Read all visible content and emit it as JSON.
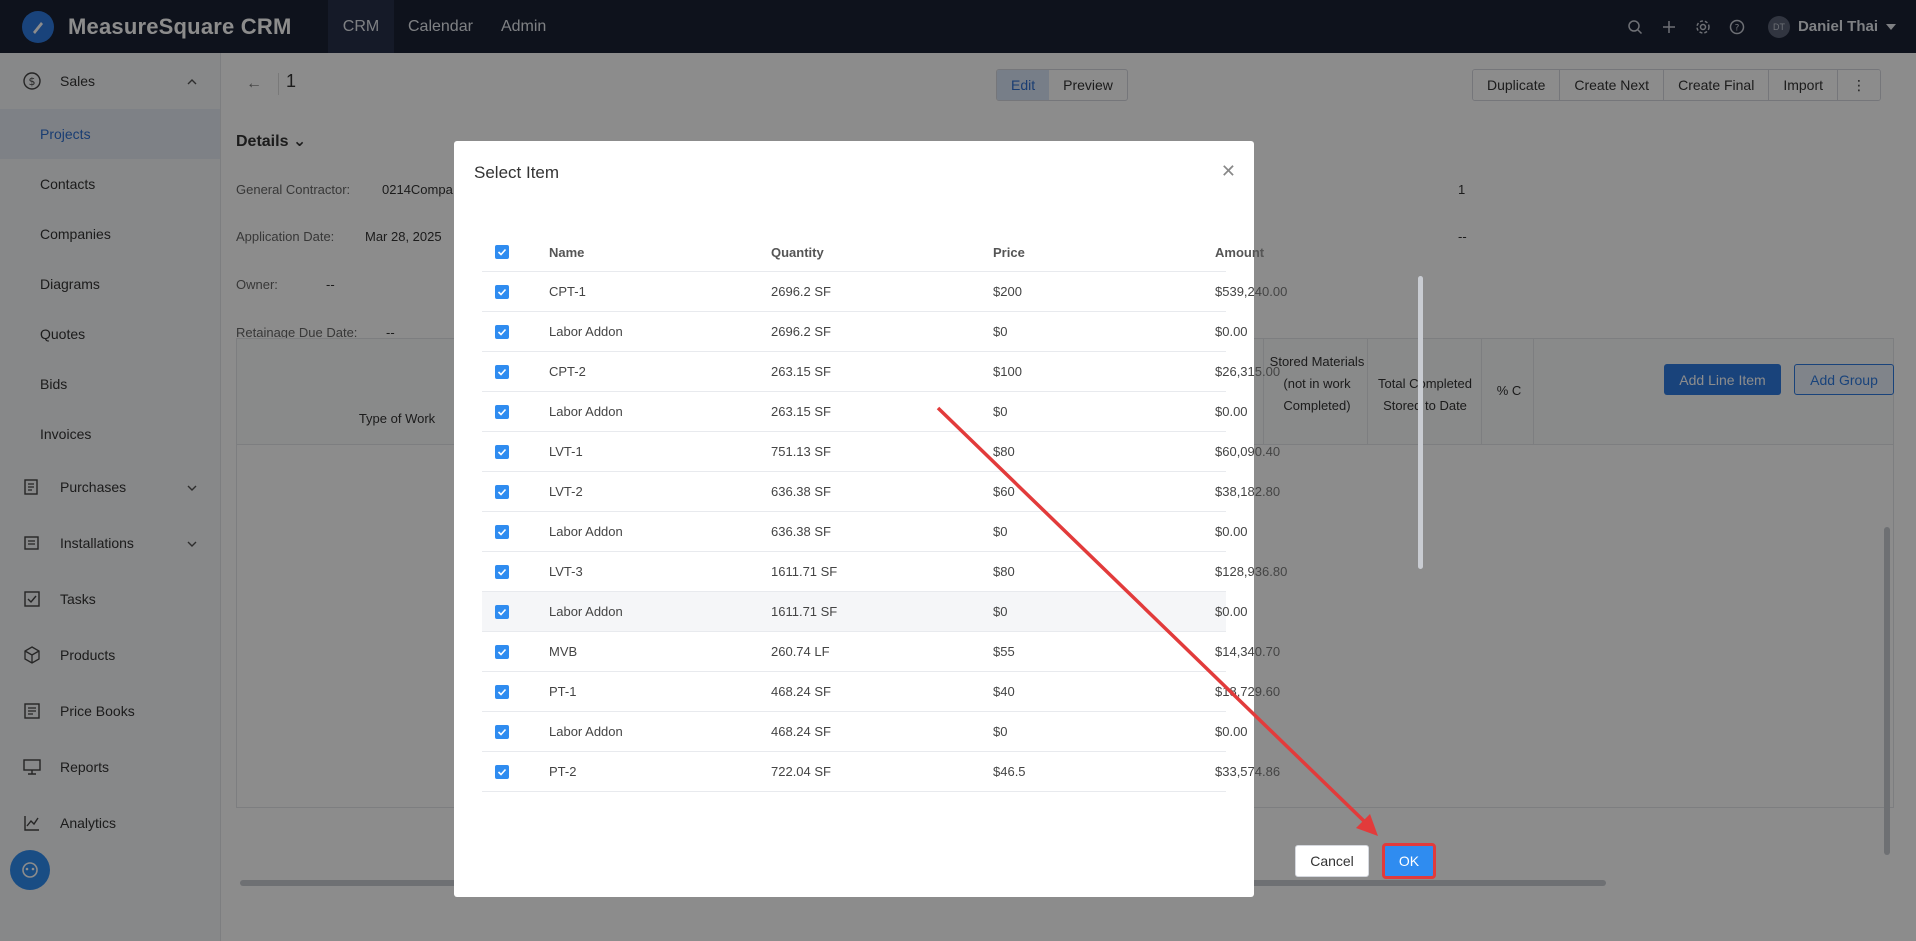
{
  "app": {
    "title": "MeasureSquare CRM"
  },
  "nav": {
    "items": [
      "CRM",
      "Calendar",
      "Admin"
    ]
  },
  "user": {
    "initials": "DT",
    "name": "Daniel Thai"
  },
  "sidebar": {
    "sales_label": "Sales",
    "sales_items": [
      "Projects",
      "Contacts",
      "Companies",
      "Diagrams",
      "Quotes",
      "Bids",
      "Invoices"
    ],
    "groups": [
      "Purchases",
      "Installations",
      "Tasks",
      "Products",
      "Price Books",
      "Reports",
      "Analytics"
    ]
  },
  "page": {
    "record_number": "1",
    "modes": [
      "Edit",
      "Preview"
    ],
    "actions": [
      "Duplicate",
      "Create Next",
      "Create Final",
      "Import",
      "⋮"
    ],
    "details_label": "Details",
    "fields": {
      "general_contractor_label": "General Contractor:",
      "general_contractor_value": "0214Compa",
      "application_date_label": "Application Date:",
      "application_date_value": "Mar 28, 2025",
      "owner_label": "Owner:",
      "owner_value": "--",
      "retainage_label": "Retainage Due Date:",
      "retainage_value": "--",
      "right_value_1": "1",
      "right_value_2": "--"
    },
    "add_line_item": "Add Line Item",
    "add_group": "Add Group",
    "grid_headers": {
      "type_of_work": "Type of Work",
      "stored_materials": "Stored Materials (not in work Completed)",
      "total_completed": "Total Completed Stored to Date",
      "percent": "% C"
    }
  },
  "modal": {
    "title": "Select Item",
    "columns": [
      "Name",
      "Quantity",
      "Price",
      "Amount"
    ],
    "rows": [
      {
        "name": "CPT-1",
        "quantity": "2696.2 SF",
        "price": "$200",
        "amount": "$539,240.00"
      },
      {
        "name": "Labor Addon",
        "quantity": "2696.2 SF",
        "price": "$0",
        "amount": "$0.00"
      },
      {
        "name": "CPT-2",
        "quantity": "263.15 SF",
        "price": "$100",
        "amount": "$26,315.00"
      },
      {
        "name": "Labor Addon",
        "quantity": "263.15 SF",
        "price": "$0",
        "amount": "$0.00"
      },
      {
        "name": "LVT-1",
        "quantity": "751.13 SF",
        "price": "$80",
        "amount": "$60,090.40"
      },
      {
        "name": "LVT-2",
        "quantity": "636.38 SF",
        "price": "$60",
        "amount": "$38,182.80"
      },
      {
        "name": "Labor Addon",
        "quantity": "636.38 SF",
        "price": "$0",
        "amount": "$0.00"
      },
      {
        "name": "LVT-3",
        "quantity": "1611.71 SF",
        "price": "$80",
        "amount": "$128,936.80"
      },
      {
        "name": "Labor Addon",
        "quantity": "1611.71 SF",
        "price": "$0",
        "amount": "$0.00"
      },
      {
        "name": "MVB",
        "quantity": "260.74 LF",
        "price": "$55",
        "amount": "$14,340.70"
      },
      {
        "name": "PT-1",
        "quantity": "468.24 SF",
        "price": "$40",
        "amount": "$18,729.60"
      },
      {
        "name": "Labor Addon",
        "quantity": "468.24 SF",
        "price": "$0",
        "amount": "$0.00"
      },
      {
        "name": "PT-2",
        "quantity": "722.04 SF",
        "price": "$46.5",
        "amount": "$33,574.86"
      }
    ],
    "cancel_label": "Cancel",
    "ok_label": "OK"
  },
  "colors": {
    "accent": "#2f8cf0",
    "topbar": "#1b2234",
    "annotation": "#e23b3b"
  }
}
